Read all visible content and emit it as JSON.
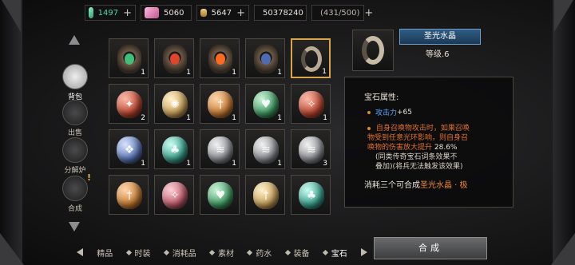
{
  "currencies": [
    {
      "icon": "green-gem-icon",
      "value": "1497",
      "color": "#4fd6a0"
    },
    {
      "icon": "pink-gem-icon",
      "value": "5060"
    },
    {
      "icon": "gold-bar-icon",
      "value": "5647"
    },
    {
      "icon": "gold-coin-icon",
      "value": "50378240"
    },
    {
      "icon": "bag-capacity-icon",
      "value": "(431/500)"
    }
  ],
  "side_tabs": [
    {
      "label": "背包",
      "icon": "bag-icon",
      "active": true
    },
    {
      "label": "出售",
      "icon": "sell-icon"
    },
    {
      "label": "分解炉",
      "icon": "decompose-furnace-icon"
    },
    {
      "label": "合成",
      "icon": "synthesis-icon",
      "badge": "!"
    }
  ],
  "grid": {
    "row1": [
      {
        "icon": "green-gem-socket-icon",
        "count": "1"
      },
      {
        "icon": "red-gem-socket-icon",
        "count": "1"
      },
      {
        "icon": "fire-gem-socket-icon",
        "count": "1"
      },
      {
        "icon": "blue-gem-socket-icon",
        "count": "1"
      },
      {
        "icon": "holy-crystal-ring-icon",
        "count": "1",
        "selected": true
      }
    ],
    "row2": [
      {
        "icon": "red-rune-gem-icon",
        "count": "2"
      },
      {
        "icon": "gold-rune-gem-icon",
        "count": "1"
      },
      {
        "icon": "orange-rune-gem-icon",
        "count": "1"
      },
      {
        "icon": "green-rune-gem-icon",
        "count": "1"
      },
      {
        "icon": "red-rune-gem-icon",
        "count": "1"
      }
    ],
    "row3": [
      {
        "icon": "blue-rune-gem-icon",
        "count": "1"
      },
      {
        "icon": "teal-rune-gem-icon",
        "count": "1"
      },
      {
        "icon": "silver-rune-gem-icon",
        "count": "1"
      },
      {
        "icon": "silver-rune-gem-icon",
        "count": "1"
      },
      {
        "icon": "silver-rune-gem-icon",
        "count": "3"
      }
    ],
    "row4": [
      {
        "icon": "orange-rune-gem-icon",
        "count": ""
      },
      {
        "icon": "pink-rune-gem-icon",
        "count": ""
      },
      {
        "icon": "green-rune-gem-icon",
        "count": ""
      },
      {
        "icon": "gold-rune-gem-icon",
        "count": ""
      },
      {
        "icon": "teal-rune-gem-icon",
        "count": ""
      }
    ]
  },
  "detail": {
    "name": "圣光水晶",
    "level": "等级.6",
    "attr_title": "宝石属性:",
    "stat_key": "攻击力",
    "stat_val": "+65",
    "effect_main": "自身召唤物攻击时，如果召唤物受到任意光环影响，则自身召唤物的伤害放大提升",
    "effect_value": "28.6%",
    "effect_note": "(同类传奇宝石词条效果不叠加)(将兵无法触发该效果)",
    "consume_prefix": "消耗三个可合成",
    "consume_target": "圣光水晶 · 极"
  },
  "bottom_tabs": [
    {
      "label": "精品"
    },
    {
      "label": "时装"
    },
    {
      "label": "消耗品"
    },
    {
      "label": "素材"
    },
    {
      "label": "药水"
    },
    {
      "label": "装备"
    },
    {
      "label": "宝石",
      "active": true
    }
  ],
  "action_label": "合成"
}
